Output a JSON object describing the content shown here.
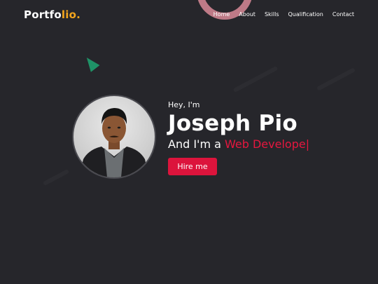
{
  "brand": {
    "logo_main": "Portfo",
    "logo_accent": "lio."
  },
  "nav": {
    "items": [
      {
        "label": "Home"
      },
      {
        "label": "About"
      },
      {
        "label": "Skills"
      },
      {
        "label": "Qualification"
      },
      {
        "label": "Contact"
      }
    ]
  },
  "hero": {
    "greeting": "Hey, I'm",
    "name": "Joseph Pio",
    "role_prefix": "And I'm a ",
    "role_typed": "Web Develope",
    "caret": "|",
    "button_label": "Hire me"
  },
  "colors": {
    "background": "#26262b",
    "accent_red": "#dc143c",
    "logo_accent": "#f3a51d",
    "ring": "#d98a98",
    "triangle": "#1f9e6e"
  }
}
